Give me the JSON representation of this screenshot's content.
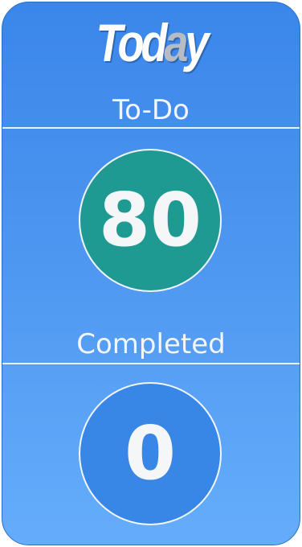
{
  "header": {
    "logo_text_start": "Tod",
    "logo_text_accent": "a",
    "logo_text_end": "y"
  },
  "todo": {
    "label": "To-Do",
    "count": "80"
  },
  "completed": {
    "label": "Completed",
    "count": "0"
  },
  "colors": {
    "background_top": "#3a86ea",
    "background_bottom": "#65adfb",
    "todo_circle": "#1f9a93",
    "completed_circle": "#3887e6",
    "text": "#f3f6fb"
  }
}
